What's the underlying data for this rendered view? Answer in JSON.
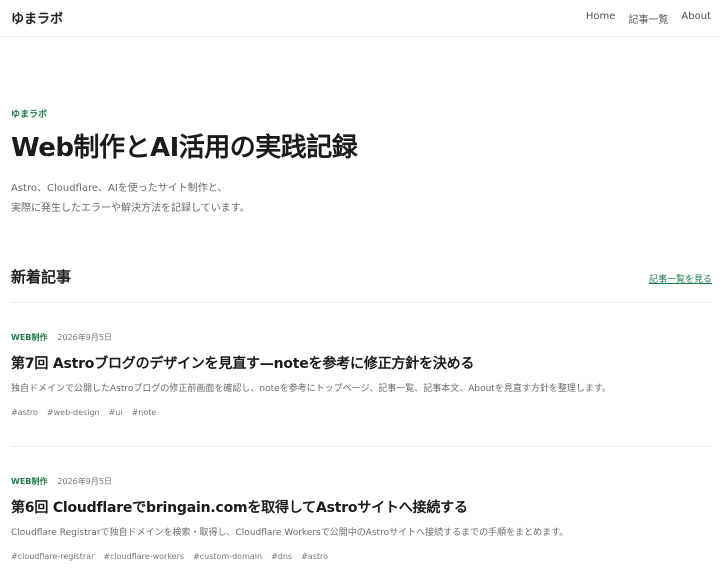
{
  "header": {
    "site_title": "ゆまラボ",
    "nav": [
      "Home",
      "記事一覧",
      "About"
    ]
  },
  "hero": {
    "eyebrow": "ゆまラボ",
    "title": "Web制作とAI活用の実践記録",
    "desc_lines": [
      "Astro、Cloudflare、AIを使ったサイト制作と、",
      "実際に発生したエラーや解決方法を記録しています。"
    ]
  },
  "latest": {
    "heading": "新着記事",
    "view_all": "記事一覧を見る",
    "articles": [
      {
        "category": "WEB制作",
        "date": "2026年9月5日",
        "title": "第7回 Astroブログのデザインを見直す—noteを参考に修正方針を決める",
        "summary": "独自ドメインで公開したAstroブログの修正前画面を確認し、noteを参考にトップページ、記事一覧、記事本文、Aboutを見直す方針を整理します。",
        "tags": [
          "#astro",
          "#web-design",
          "#ui",
          "#note"
        ]
      },
      {
        "category": "WEB制作",
        "date": "2026年9月5日",
        "title": "第6回 Cloudflareでbringain.comを取得してAstroサイトへ接続する",
        "summary": "Cloudflare Registrarで独自ドメインを検索・取得し、Cloudflare Workersで公開中のAstroサイトへ接続するまでの手順をまとめます。",
        "tags": [
          "#cloudflare-registrar",
          "#cloudflare-workers",
          "#custom-domain",
          "#dns",
          "#astro"
        ]
      }
    ]
  }
}
